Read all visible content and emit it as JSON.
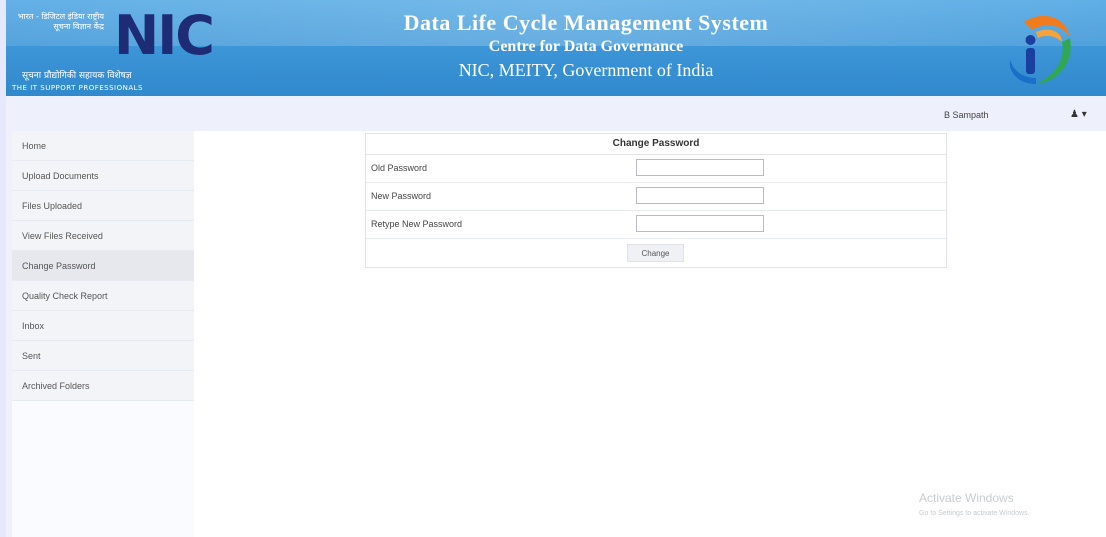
{
  "header": {
    "logo_hindi_top": "भारत - डिजिटल इंडिया राष्ट्रीय सूचना विज्ञान केंद्र",
    "logo_letters": "NIC",
    "logo_hindi_bottom": "सूचना प्रौद्योगिकी सहायक विशेषज्ञ",
    "logo_tagline": "THE IT SUPPORT PROFESSIONALS",
    "title_line1": "Data Life Cycle Management System",
    "title_line2": "Centre for Data Governance",
    "title_line3": "NIC, MEITY, Government of India",
    "accent_colors": {
      "banner": "#3b94d6",
      "nic_blue": "#1d2c74",
      "saffron": "#f07c1e",
      "india_blue": "#1a6fc9"
    }
  },
  "user": {
    "name": "B Sampath",
    "menu_icon": "user-dropdown-icon",
    "menu_glyph": "♟ ▾"
  },
  "sidebar": {
    "items": [
      {
        "label": "Home"
      },
      {
        "label": "Upload Documents"
      },
      {
        "label": "Files Uploaded"
      },
      {
        "label": "View Files Received"
      },
      {
        "label": "Change Password"
      },
      {
        "label": "Quality Check Report"
      },
      {
        "label": "Inbox"
      },
      {
        "label": "Sent"
      },
      {
        "label": "Archived Folders"
      }
    ],
    "active": "Change Password"
  },
  "form": {
    "title": "Change Password",
    "fields": [
      {
        "label": "Old Password",
        "value": ""
      },
      {
        "label": "New Password",
        "value": ""
      },
      {
        "label": "Retype New Password",
        "value": ""
      }
    ],
    "submit_label": "Change"
  },
  "watermark": {
    "line1": "Activate Windows",
    "line2": "Go to Settings to activate Windows."
  }
}
